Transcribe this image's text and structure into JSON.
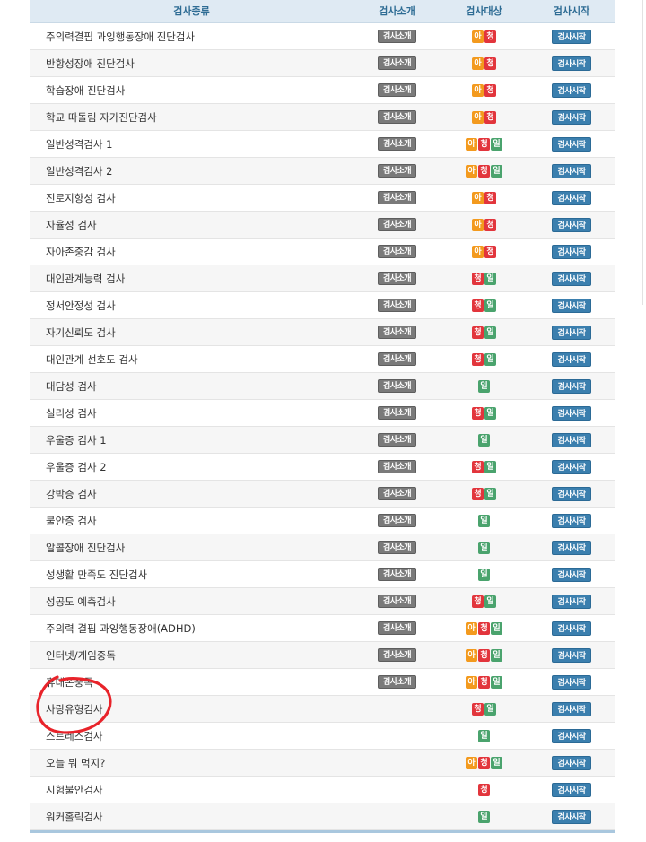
{
  "header": {
    "col_name": "검사종류",
    "col_intro": "검사소개",
    "col_target": "검사대상",
    "col_start": "검사시작"
  },
  "badge_labels": {
    "a": "아",
    "c": "청",
    "i": "일"
  },
  "intro_label": "검사소개",
  "start_label": "검사시작",
  "rows": [
    {
      "name": "주의력결핍 과잉행동장애 진단검사",
      "intro": true,
      "targets": [
        "a",
        "c"
      ]
    },
    {
      "name": "반항성장애 진단검사",
      "intro": true,
      "targets": [
        "a",
        "c"
      ]
    },
    {
      "name": "학습장애 진단검사",
      "intro": true,
      "targets": [
        "a",
        "c"
      ]
    },
    {
      "name": "학교 따돌림 자가진단검사",
      "intro": true,
      "targets": [
        "a",
        "c"
      ]
    },
    {
      "name": "일반성격검사 1",
      "intro": true,
      "targets": [
        "a",
        "c",
        "i"
      ]
    },
    {
      "name": "일반성격검사 2",
      "intro": true,
      "targets": [
        "a",
        "c",
        "i"
      ]
    },
    {
      "name": "진로지향성 검사",
      "intro": true,
      "targets": [
        "a",
        "c"
      ]
    },
    {
      "name": "자율성 검사",
      "intro": true,
      "targets": [
        "a",
        "c"
      ]
    },
    {
      "name": "자아존중감 검사",
      "intro": true,
      "targets": [
        "a",
        "c"
      ]
    },
    {
      "name": "대인관계능력 검사",
      "intro": true,
      "targets": [
        "c",
        "i"
      ]
    },
    {
      "name": "정서안정성 검사",
      "intro": true,
      "targets": [
        "c",
        "i"
      ]
    },
    {
      "name": "자기신뢰도 검사",
      "intro": true,
      "targets": [
        "c",
        "i"
      ]
    },
    {
      "name": "대인관계 선호도 검사",
      "intro": true,
      "targets": [
        "c",
        "i"
      ]
    },
    {
      "name": "대담성 검사",
      "intro": true,
      "targets": [
        "i"
      ]
    },
    {
      "name": "실리성 검사",
      "intro": true,
      "targets": [
        "c",
        "i"
      ]
    },
    {
      "name": "우울증 검사 1",
      "intro": true,
      "targets": [
        "i"
      ]
    },
    {
      "name": "우울증 검사 2",
      "intro": true,
      "targets": [
        "c",
        "i"
      ]
    },
    {
      "name": "강박증 검사",
      "intro": true,
      "targets": [
        "c",
        "i"
      ]
    },
    {
      "name": "불안증 검사",
      "intro": true,
      "targets": [
        "i"
      ]
    },
    {
      "name": "알콜장애 진단검사",
      "intro": true,
      "targets": [
        "i"
      ]
    },
    {
      "name": "성생활 만족도 진단검사",
      "intro": true,
      "targets": [
        "i"
      ]
    },
    {
      "name": "성공도 예측검사",
      "intro": true,
      "targets": [
        "c",
        "i"
      ]
    },
    {
      "name": "주의력 결핍 과잉행동장애(ADHD)",
      "intro": true,
      "targets": [
        "a",
        "c",
        "i"
      ]
    },
    {
      "name": "인터넷/게임중독",
      "intro": true,
      "targets": [
        "a",
        "c",
        "i"
      ]
    },
    {
      "name": "휴대폰중독",
      "intro": true,
      "targets": [
        "a",
        "c",
        "i"
      ]
    },
    {
      "name": "사랑유형검사",
      "intro": false,
      "targets": [
        "c",
        "i"
      ]
    },
    {
      "name": "스트레스검사",
      "intro": false,
      "targets": [
        "i"
      ]
    },
    {
      "name": "오늘 뭐 먹지?",
      "intro": false,
      "targets": [
        "a",
        "c",
        "i"
      ]
    },
    {
      "name": "시험불안검사",
      "intro": false,
      "targets": [
        "c"
      ]
    },
    {
      "name": "워커홀릭검사",
      "intro": false,
      "targets": [
        "i"
      ]
    }
  ],
  "annotation_color": "#e8232a"
}
